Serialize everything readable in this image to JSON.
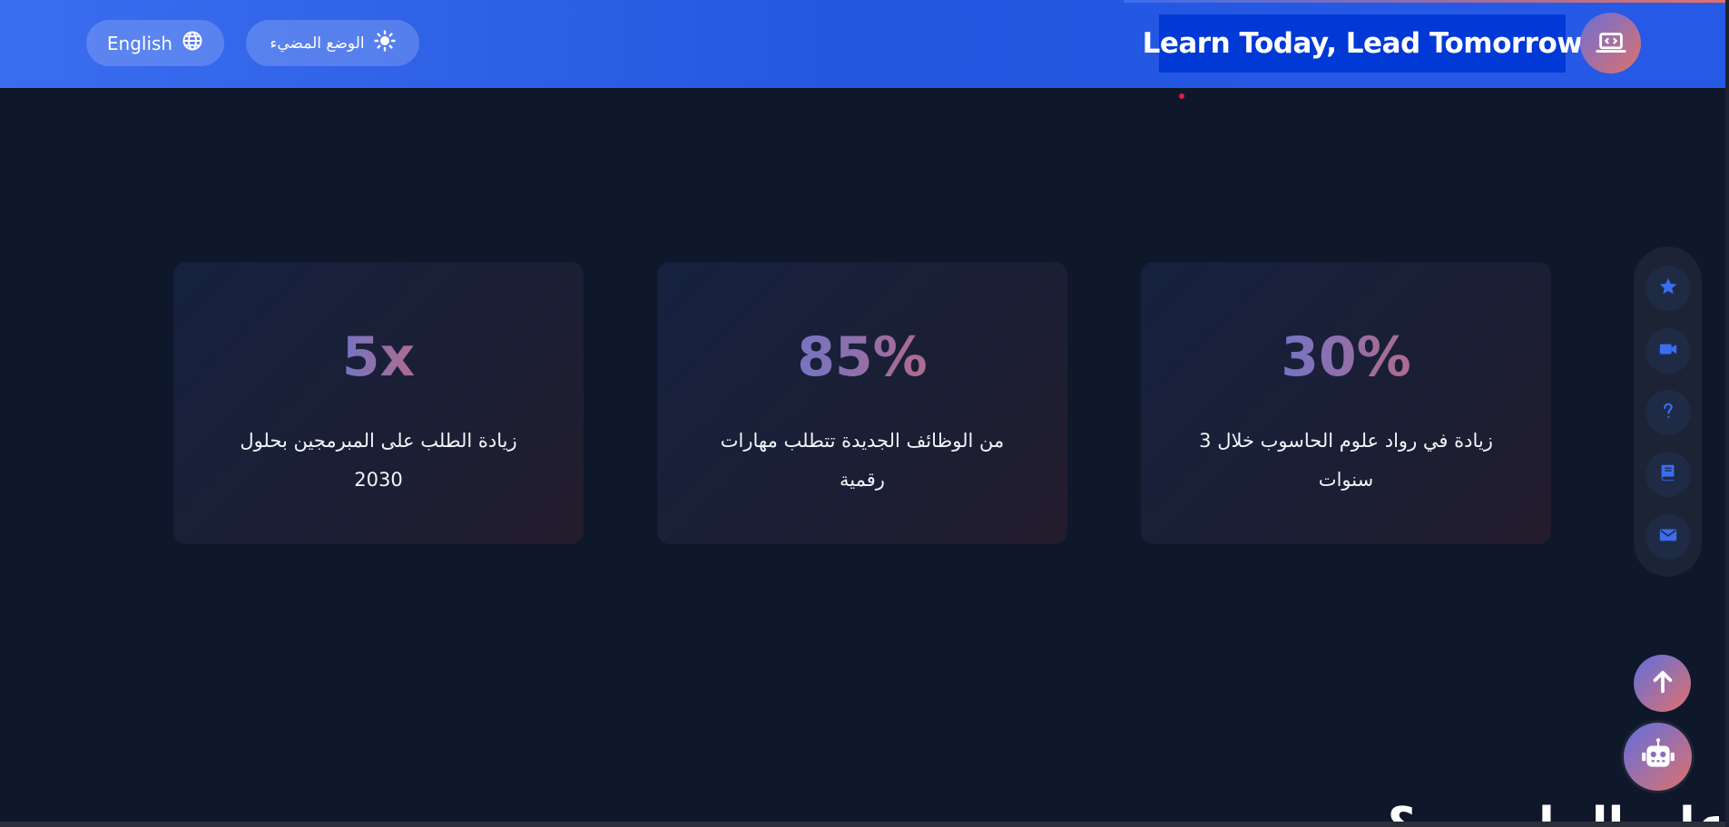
{
  "header": {
    "brand_title": "Learn Today, Lead Tomorrow",
    "language_button": "English",
    "theme_button": "الوضع المضيء"
  },
  "stats": [
    {
      "value": "5x",
      "label": "زيادة الطلب على المبرمجين بحلول 2030"
    },
    {
      "value": "85%",
      "label": "من الوظائف الجديدة تتطلب مهارات رقمية"
    },
    {
      "value": "30%",
      "label": "زيادة في رواد علوم الحاسوب خلال 3 سنوات"
    }
  ],
  "side_nav": {
    "icons": [
      "star-icon",
      "video-icon",
      "question-icon",
      "book-icon",
      "envelope-icon"
    ]
  },
  "next_section": {
    "heading_partial": "علم الحاسوب؟"
  },
  "colors": {
    "header": "#2457e0",
    "page_bg": "#0f172a",
    "accent_gradient_start": "#7474c4",
    "accent_gradient_end": "#e0706a",
    "title_highlight": "#0039d6"
  }
}
